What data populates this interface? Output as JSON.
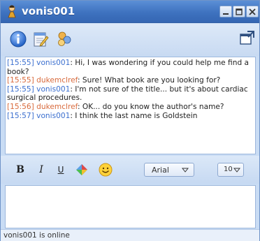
{
  "window": {
    "title": "vonis001",
    "accent": "#3e72bf",
    "icons": [
      "person-icon",
      "minimize-icon",
      "maximize-icon",
      "close-icon"
    ]
  },
  "toolbar": {
    "icons": [
      "info-icon",
      "notepad-icon",
      "people-icon",
      "popout-icon"
    ]
  },
  "chat": {
    "messages": [
      {
        "time": "[15:55]",
        "user": "vonis001",
        "text": "Hi, I was wondering if you could help me find a book?",
        "color": "#3b6fcf"
      },
      {
        "time": "[15:55]",
        "user": "dukemclref",
        "text": "Sure! What book are you looking for?",
        "color": "#d86a3c"
      },
      {
        "time": "[15:55]",
        "user": "vonis001",
        "text": "I'm not sure of the title... but it's about cardiac surgical procedures.",
        "color": "#3b6fcf"
      },
      {
        "time": "[15:56]",
        "user": "dukemclref",
        "text": "OK... do you know the author's name?",
        "color": "#d86a3c"
      },
      {
        "time": "[15:57]",
        "user": "vonis001",
        "text": "I think the last name is Goldstein",
        "color": "#3b6fcf"
      }
    ]
  },
  "format": {
    "bold": "B",
    "italic": "I",
    "underline": "U",
    "font": "Arial",
    "size": "10",
    "icons": [
      "text-color-icon",
      "emoticon-icon",
      "chevron-down-icon"
    ]
  },
  "status": {
    "text": "vonis001 is online"
  }
}
